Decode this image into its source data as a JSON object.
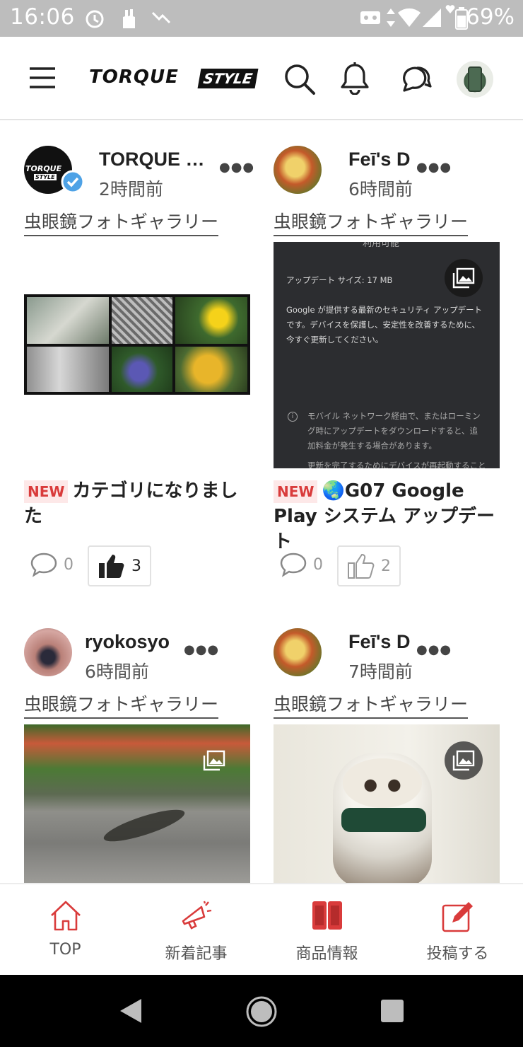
{
  "status_bar": {
    "time": "16:06",
    "battery": "69%"
  },
  "header": {
    "logo_word": "TORQUE",
    "logo_badge": "STYLE",
    "menu_icon": "hamburger-icon",
    "search_icon": "search-icon",
    "bell_icon": "bell-icon",
    "chat_icon": "chat-icon"
  },
  "posts": [
    {
      "author": "TORQUE …",
      "time": "2時間前",
      "category": "虫眼鏡フォトギャラリー",
      "new_badge": "NEW",
      "title": "カテゴリになりました",
      "comments": "0",
      "likes": "3",
      "liked": true,
      "verified": true
    },
    {
      "author": "Feī's D",
      "time": "6時間前",
      "category": "虫眼鏡フォトギャラリー",
      "new_badge": "NEW",
      "title": "🌏G07 Google Play システム アップデート",
      "comments": "0",
      "likes": "2",
      "liked": false,
      "screenshot_text": {
        "top": "利用可能",
        "size": "アップデート サイズ: 17 MB",
        "body": "Google が提供する最新のセキュリティ アップデートです。デバイスを保護し、安定性を改善するために、今すぐ更新してください。",
        "note": "モバイル ネットワーク経由で、またはローミング時にアップデートをダウンロードすると、追加料金が発生する場合があります。",
        "footer": "更新を完了するためにデバイスが再起動すること"
      }
    },
    {
      "author": "ryokosyo",
      "time": "6時間前",
      "category": "虫眼鏡フォトギャラリー"
    },
    {
      "author": "Feī's D",
      "time": "7時間前",
      "category": "虫眼鏡フォトギャラリー"
    }
  ],
  "bottom_nav": [
    {
      "label": "TOP",
      "icon": "home-icon"
    },
    {
      "label": "新着記事",
      "icon": "megaphone-icon"
    },
    {
      "label": "商品情報",
      "icon": "phone-icon"
    },
    {
      "label": "投稿する",
      "icon": "edit-icon"
    }
  ],
  "colors": {
    "accent": "#d93b3b",
    "status_bar": "#bdbdbd"
  }
}
